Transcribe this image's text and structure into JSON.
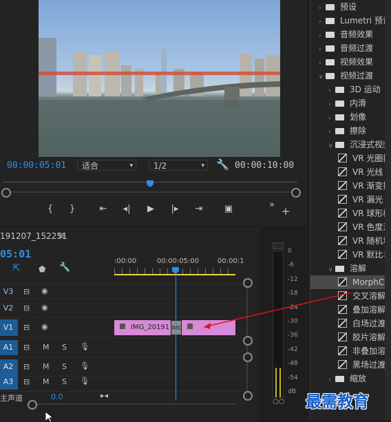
{
  "monitor": {
    "current_time": "00:00:05:01",
    "fit_label": "适合",
    "resolution_label": "1/2",
    "duration": "00:00:10:00",
    "playhead_fraction": 0.5
  },
  "timeline": {
    "sequence_name": "191207_152251",
    "current_time": "05:01",
    "ruler_ticks": [
      ":00:00",
      "00:00:05:00",
      "00:00:1"
    ],
    "tracks": [
      {
        "label": "V3"
      },
      {
        "label": "V2"
      },
      {
        "label": "V1"
      },
      {
        "label": "A1",
        "m": "M",
        "s": "S"
      },
      {
        "label": "A2",
        "m": "M",
        "s": "S"
      },
      {
        "label": "A3",
        "m": "M",
        "s": "S"
      }
    ],
    "master_label": "主声道",
    "master_value": "0.0",
    "clip1_name": "IMG_20191",
    "transition_label": "IMG",
    "clip2_name": "IMG_20191"
  },
  "meter": {
    "scale": [
      "0",
      "-6",
      "-12",
      "-18",
      "-24",
      "-30",
      "-36",
      "-42",
      "-48",
      "-54",
      "dB"
    ]
  },
  "effects": {
    "items": [
      {
        "label": "预设",
        "type": "folder",
        "indent": 0,
        "open": false
      },
      {
        "label": "Lumetri 预设",
        "type": "folder",
        "indent": 0,
        "open": false
      },
      {
        "label": "音频效果",
        "type": "folder",
        "indent": 0,
        "open": false
      },
      {
        "label": "音频过渡",
        "type": "folder",
        "indent": 0,
        "open": false
      },
      {
        "label": "视频效果",
        "type": "folder",
        "indent": 0,
        "open": false
      },
      {
        "label": "视频过渡",
        "type": "folder",
        "indent": 0,
        "open": true
      },
      {
        "label": "3D 运动",
        "type": "folder",
        "indent": 1,
        "open": false
      },
      {
        "label": "内滑",
        "type": "folder",
        "indent": 1,
        "open": false
      },
      {
        "label": "划像",
        "type": "folder",
        "indent": 1,
        "open": false
      },
      {
        "label": "擦除",
        "type": "folder",
        "indent": 1,
        "open": false
      },
      {
        "label": "沉浸式视频",
        "type": "folder",
        "indent": 1,
        "open": true
      },
      {
        "label": "VR 光圈擦除",
        "type": "effect",
        "indent": 2
      },
      {
        "label": "VR 光线",
        "type": "effect",
        "indent": 2
      },
      {
        "label": "VR 渐变擦除",
        "type": "effect",
        "indent": 2
      },
      {
        "label": "VR 漏光",
        "type": "effect",
        "indent": 2
      },
      {
        "label": "VR 球形模糊",
        "type": "effect",
        "indent": 2
      },
      {
        "label": "VR 色度泄漏",
        "type": "effect",
        "indent": 2
      },
      {
        "label": "VR 随机块",
        "type": "effect",
        "indent": 2
      },
      {
        "label": "VR 默比乌斯缩放",
        "type": "effect",
        "indent": 2
      },
      {
        "label": "溶解",
        "type": "folder",
        "indent": 1,
        "open": true
      },
      {
        "label": "MorphCut",
        "type": "effect",
        "indent": 2,
        "highlight": true
      },
      {
        "label": "交叉溶解",
        "type": "effect",
        "indent": 2
      },
      {
        "label": "叠加溶解",
        "type": "effect",
        "indent": 2
      },
      {
        "label": "白场过渡",
        "type": "effect",
        "indent": 2
      },
      {
        "label": "胶片溶解",
        "type": "effect",
        "indent": 2
      },
      {
        "label": "非叠加溶解",
        "type": "effect",
        "indent": 2
      },
      {
        "label": "黑场过渡",
        "type": "effect",
        "indent": 2
      },
      {
        "label": "缩放",
        "type": "folder",
        "indent": 1,
        "open": false
      }
    ]
  },
  "watermark": "最需教育",
  "colors": {
    "accent_blue": "#2f8de4",
    "clip_pink": "#d68ad7",
    "playhead": "#2f8de4"
  }
}
